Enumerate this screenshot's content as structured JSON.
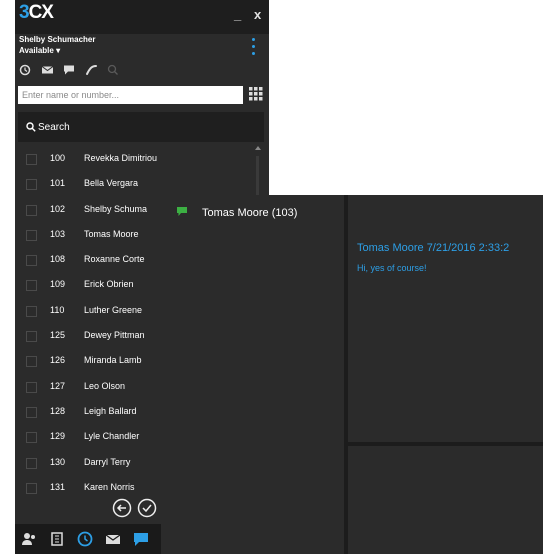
{
  "app": {
    "logo": "CX",
    "logo_prefix": "3",
    "minimize": "_",
    "close": "x",
    "user_name": "Shelby Schumacher",
    "status": "Available",
    "status_caret": "▾"
  },
  "toolbar_icons": [
    "history-icon",
    "voicemail-icon",
    "chat-icon",
    "call-icon",
    "search-icon"
  ],
  "search": {
    "placeholder": "Enter name or number...",
    "button_label": "Search"
  },
  "contacts": [
    {
      "ext": "100",
      "name": "Revekka Dimitriou"
    },
    {
      "ext": "101",
      "name": "Bella Vergara"
    },
    {
      "ext": "102",
      "name": "Shelby Schuma"
    },
    {
      "ext": "103",
      "name": "Tomas Moore"
    },
    {
      "ext": "108",
      "name": "Roxanne Corte"
    },
    {
      "ext": "109",
      "name": "Erick Obrien"
    },
    {
      "ext": "110",
      "name": "Luther Greene"
    },
    {
      "ext": "125",
      "name": "Dewey Pittman"
    },
    {
      "ext": "126",
      "name": "Miranda Lamb"
    },
    {
      "ext": "127",
      "name": "Leo Olson"
    },
    {
      "ext": "128",
      "name": "Leigh Ballard"
    },
    {
      "ext": "129",
      "name": "Lyle Chandler"
    },
    {
      "ext": "130",
      "name": "Darryl Terry"
    },
    {
      "ext": "131",
      "name": "Karen Norris"
    }
  ],
  "bottom_nav": [
    "contacts-icon",
    "phonebook-icon",
    "history-icon",
    "voicemail-icon",
    "chat-icon"
  ],
  "chat": {
    "conversation_label": "Tomas Moore (103)",
    "message_header": "Tomas Moore 7/21/2016 2:33:2",
    "message_text": "Hi, yes of course!"
  },
  "colors": {
    "accent": "#2d9fe6",
    "panel": "#2b2b2b",
    "titlebar": "#1e1e1e",
    "online": "#3cb043"
  }
}
